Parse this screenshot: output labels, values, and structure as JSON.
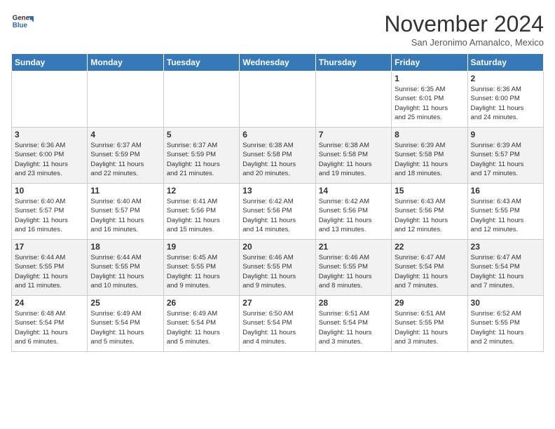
{
  "header": {
    "logo_line1": "General",
    "logo_line2": "Blue",
    "month_title": "November 2024",
    "location": "San Jeronimo Amanalco, Mexico"
  },
  "days_of_week": [
    "Sunday",
    "Monday",
    "Tuesday",
    "Wednesday",
    "Thursday",
    "Friday",
    "Saturday"
  ],
  "weeks": [
    [
      {
        "day": null,
        "info": null
      },
      {
        "day": null,
        "info": null
      },
      {
        "day": null,
        "info": null
      },
      {
        "day": null,
        "info": null
      },
      {
        "day": null,
        "info": null
      },
      {
        "day": "1",
        "info": "Sunrise: 6:35 AM\nSunset: 6:01 PM\nDaylight: 11 hours\nand 25 minutes."
      },
      {
        "day": "2",
        "info": "Sunrise: 6:36 AM\nSunset: 6:00 PM\nDaylight: 11 hours\nand 24 minutes."
      }
    ],
    [
      {
        "day": "3",
        "info": "Sunrise: 6:36 AM\nSunset: 6:00 PM\nDaylight: 11 hours\nand 23 minutes."
      },
      {
        "day": "4",
        "info": "Sunrise: 6:37 AM\nSunset: 5:59 PM\nDaylight: 11 hours\nand 22 minutes."
      },
      {
        "day": "5",
        "info": "Sunrise: 6:37 AM\nSunset: 5:59 PM\nDaylight: 11 hours\nand 21 minutes."
      },
      {
        "day": "6",
        "info": "Sunrise: 6:38 AM\nSunset: 5:58 PM\nDaylight: 11 hours\nand 20 minutes."
      },
      {
        "day": "7",
        "info": "Sunrise: 6:38 AM\nSunset: 5:58 PM\nDaylight: 11 hours\nand 19 minutes."
      },
      {
        "day": "8",
        "info": "Sunrise: 6:39 AM\nSunset: 5:58 PM\nDaylight: 11 hours\nand 18 minutes."
      },
      {
        "day": "9",
        "info": "Sunrise: 6:39 AM\nSunset: 5:57 PM\nDaylight: 11 hours\nand 17 minutes."
      }
    ],
    [
      {
        "day": "10",
        "info": "Sunrise: 6:40 AM\nSunset: 5:57 PM\nDaylight: 11 hours\nand 16 minutes."
      },
      {
        "day": "11",
        "info": "Sunrise: 6:40 AM\nSunset: 5:57 PM\nDaylight: 11 hours\nand 16 minutes."
      },
      {
        "day": "12",
        "info": "Sunrise: 6:41 AM\nSunset: 5:56 PM\nDaylight: 11 hours\nand 15 minutes."
      },
      {
        "day": "13",
        "info": "Sunrise: 6:42 AM\nSunset: 5:56 PM\nDaylight: 11 hours\nand 14 minutes."
      },
      {
        "day": "14",
        "info": "Sunrise: 6:42 AM\nSunset: 5:56 PM\nDaylight: 11 hours\nand 13 minutes."
      },
      {
        "day": "15",
        "info": "Sunrise: 6:43 AM\nSunset: 5:56 PM\nDaylight: 11 hours\nand 12 minutes."
      },
      {
        "day": "16",
        "info": "Sunrise: 6:43 AM\nSunset: 5:55 PM\nDaylight: 11 hours\nand 12 minutes."
      }
    ],
    [
      {
        "day": "17",
        "info": "Sunrise: 6:44 AM\nSunset: 5:55 PM\nDaylight: 11 hours\nand 11 minutes."
      },
      {
        "day": "18",
        "info": "Sunrise: 6:44 AM\nSunset: 5:55 PM\nDaylight: 11 hours\nand 10 minutes."
      },
      {
        "day": "19",
        "info": "Sunrise: 6:45 AM\nSunset: 5:55 PM\nDaylight: 11 hours\nand 9 minutes."
      },
      {
        "day": "20",
        "info": "Sunrise: 6:46 AM\nSunset: 5:55 PM\nDaylight: 11 hours\nand 9 minutes."
      },
      {
        "day": "21",
        "info": "Sunrise: 6:46 AM\nSunset: 5:55 PM\nDaylight: 11 hours\nand 8 minutes."
      },
      {
        "day": "22",
        "info": "Sunrise: 6:47 AM\nSunset: 5:54 PM\nDaylight: 11 hours\nand 7 minutes."
      },
      {
        "day": "23",
        "info": "Sunrise: 6:47 AM\nSunset: 5:54 PM\nDaylight: 11 hours\nand 7 minutes."
      }
    ],
    [
      {
        "day": "24",
        "info": "Sunrise: 6:48 AM\nSunset: 5:54 PM\nDaylight: 11 hours\nand 6 minutes."
      },
      {
        "day": "25",
        "info": "Sunrise: 6:49 AM\nSunset: 5:54 PM\nDaylight: 11 hours\nand 5 minutes."
      },
      {
        "day": "26",
        "info": "Sunrise: 6:49 AM\nSunset: 5:54 PM\nDaylight: 11 hours\nand 5 minutes."
      },
      {
        "day": "27",
        "info": "Sunrise: 6:50 AM\nSunset: 5:54 PM\nDaylight: 11 hours\nand 4 minutes."
      },
      {
        "day": "28",
        "info": "Sunrise: 6:51 AM\nSunset: 5:54 PM\nDaylight: 11 hours\nand 3 minutes."
      },
      {
        "day": "29",
        "info": "Sunrise: 6:51 AM\nSunset: 5:55 PM\nDaylight: 11 hours\nand 3 minutes."
      },
      {
        "day": "30",
        "info": "Sunrise: 6:52 AM\nSunset: 5:55 PM\nDaylight: 11 hours\nand 2 minutes."
      }
    ]
  ]
}
